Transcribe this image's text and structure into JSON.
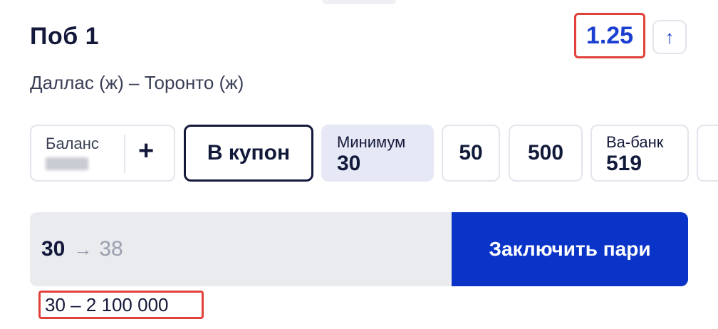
{
  "bet": {
    "title": "Поб 1",
    "subtitle": "Даллас (ж) – Торонто (ж)",
    "odds": "1.25",
    "odds_trend_icon": "arrow-up-icon"
  },
  "chips": {
    "balance_label": "Баланс",
    "add_icon": "+",
    "coupon_label": "В купон",
    "min_label": "Минимум",
    "min_value": "30",
    "amount_50": "50",
    "amount_500": "500",
    "allin_label": "Ва-банк",
    "allin_value": "519"
  },
  "stake": {
    "value": "30",
    "arrow": "→",
    "potential_win": "38",
    "button_label": "Заключить пари",
    "range": "30 – 2 100 000"
  },
  "colors": {
    "accent": "#0a34c8",
    "odds": "#1a3fd1",
    "highlight": "#e0413a"
  }
}
